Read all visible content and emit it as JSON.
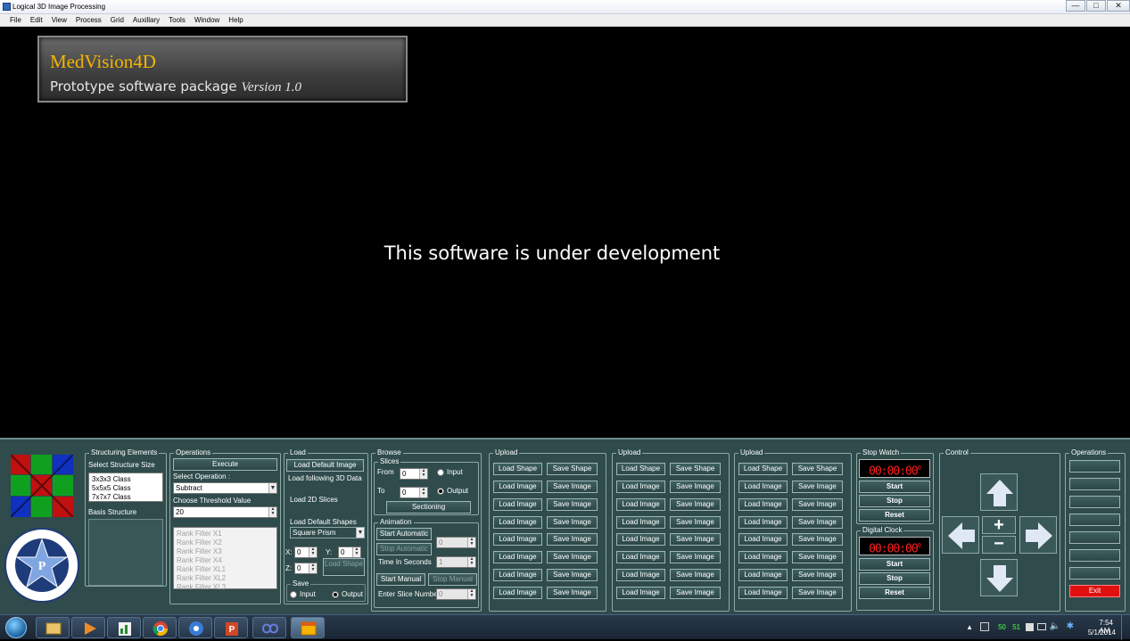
{
  "window": {
    "title": "Logical 3D Image Processing",
    "controls": [
      "—",
      "□",
      "✕"
    ]
  },
  "menu": [
    "File",
    "Edit",
    "View",
    "Process",
    "Grid",
    "Auxillary",
    "Tools",
    "Window",
    "Help"
  ],
  "banner": {
    "title": "MedVision4D",
    "subtitle": "Prototype software package",
    "version": "Version 1.0"
  },
  "message": "This software is under development",
  "structuring": {
    "label": "Structuring Elements",
    "select_label": "Select Structure Size",
    "sizes": [
      "3x3x3 Class",
      "5x5x5 Class",
      "7x7x7 Class"
    ],
    "basis_label": "Basis Structure",
    "logo_text_top": "Pandiyan Research Centre Private Limited",
    "logo_text_bottom": "Hyderabad, India",
    "logo_letter": "P"
  },
  "operations": {
    "label": "Operations",
    "execute": "Execute",
    "select_label": "Select Operation :",
    "operation_value": "Subtract",
    "threshold_label": "Choose Threshold Value",
    "threshold_value": "20",
    "filters": [
      "Rank Filter X1",
      "Rank Filter X2",
      "Rank Filter X3",
      "Rank Filter X4",
      "Rank Filter XL1",
      "Rank Filter XL2",
      "Rank Filter XL3"
    ]
  },
  "load": {
    "label": "Load",
    "default_image": "Load Default Image",
    "following_3d": "Load following 3D Data",
    "load_2d": "Load 2D Slices",
    "default_shapes": "Load Default Shapes",
    "shape_value": "Square Prism",
    "x_label": "X:",
    "y_label": "Y:",
    "z_label": "Z:",
    "x": "0",
    "y": "0",
    "z": "0",
    "load_shape": "Load Shape",
    "save_label": "Save",
    "input": "Input",
    "output": "Output"
  },
  "browse": {
    "label": "Browse",
    "slices_label": "Slices",
    "from_label": "From",
    "from_value": "0",
    "to_label": "To",
    "to_value": "0",
    "input": "Input",
    "output": "Output",
    "sectioning": "Sectioning",
    "animation_label": "Animation",
    "start_auto": "Start Automatic",
    "stop_auto": "Stop Automatic",
    "auto_value": "0",
    "time_label": "Time In Seconds",
    "time_value": "1",
    "start_manual": "Start Manual",
    "stop_manual": "Stop Manual",
    "slice_label": "Enter Slice Number",
    "slice_value": "0"
  },
  "upload_groups": [
    {
      "label": "Upload",
      "load_shape": "Load Shape",
      "save_shape": "Save Shape",
      "load_image": "Load Image",
      "save_image": "Save Image"
    },
    {
      "label": "Upload",
      "load_shape": "Load Shape",
      "save_shape": "Save Shape",
      "load_image": "Load Image",
      "save_image": "Save Image"
    },
    {
      "label": "Upload",
      "load_shape": "Load Shape",
      "save_shape": "Save Shape",
      "load_image": "Load Image",
      "save_image": "Save Image"
    }
  ],
  "stopwatch": {
    "label": "Stop Watch",
    "display": "00:00:00",
    "sub": "0",
    "start": "Start",
    "stop": "Stop",
    "reset": "Reset"
  },
  "clock": {
    "label": "Digital Clock",
    "display": "00:00:00",
    "sub": "0",
    "start": "Start",
    "stop": "Stop",
    "reset": "Reset"
  },
  "control": {
    "label": "Control",
    "plus": "+",
    "minus": "−"
  },
  "ops_right": {
    "label": "Operations",
    "exit": "Exit"
  },
  "taskbar": {
    "tray_50": "50",
    "tray_51": "51",
    "time": "7:54 AM",
    "date": "5/1/2014"
  },
  "colors": {
    "panel": "#2f4b4b",
    "accent": "#f4b400",
    "exit": "#e01010",
    "led": "#ff2020"
  }
}
